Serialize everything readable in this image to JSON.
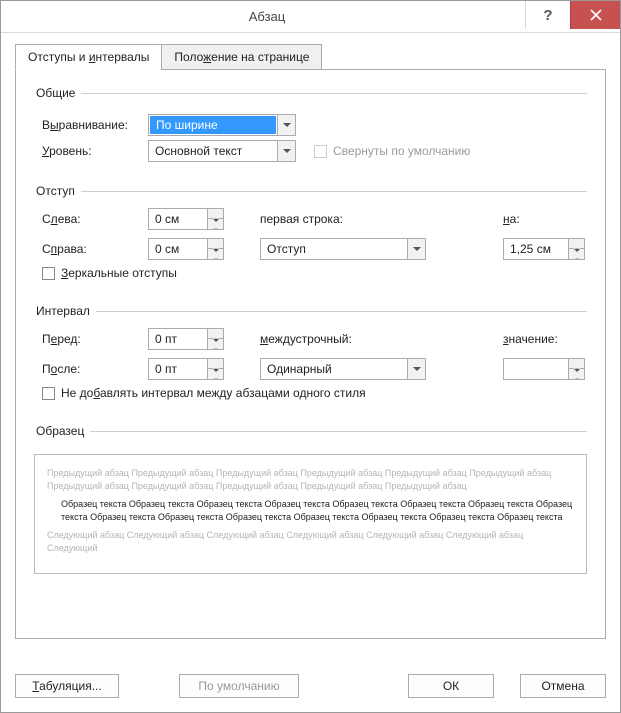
{
  "title": "Абзац",
  "tabs": {
    "indents": "Отступы и интервалы",
    "position": "Положение на странице"
  },
  "groups": {
    "general": "Общие",
    "indent": "Отступ",
    "interval": "Интервал",
    "preview": "Образец"
  },
  "general": {
    "align_label": "Выравнивание:",
    "align_value": "По ширине",
    "level_label": "Уровень:",
    "level_value": "Основной текст",
    "collapsed_label": "Свернуты по умолчанию"
  },
  "indent": {
    "left_label": "Слева:",
    "left_value": "0 см",
    "right_label": "Справа:",
    "right_value": "0 см",
    "first_line_label": "первая строка:",
    "first_combo_value": "Отступ",
    "on_label": "на:",
    "on_value": "1,25 см",
    "mirror_label": "Зеркальные отступы"
  },
  "interval": {
    "before_label": "Перед:",
    "before_value": "0 пт",
    "after_label": "После:",
    "after_value": "0 пт",
    "line_label": "междустрочный:",
    "line_value": "Одинарный",
    "value_label": "значение:",
    "value_value": "",
    "dont_add_label": "Не добавлять интервал между абзацами одного стиля"
  },
  "preview": {
    "prev_text": "Предыдущий абзац Предыдущий абзац Предыдущий абзац Предыдущий абзац Предыдущий абзац Предыдущий абзац Предыдущий абзац Предыдущий абзац Предыдущий абзац Предыдущий абзац Предыдущий абзац",
    "sample_text": "Образец текста Образец текста Образец текста Образец текста Образец текста Образец текста Образец текста Образец текста Образец текста Образец текста Образец текста Образец текста Образец текста Образец текста Образец текста",
    "next_text": "Следующий абзац Следующий абзац Следующий абзац Следующий абзац Следующий абзац Следующий абзац Следующий"
  },
  "buttons": {
    "tabs": "Табуляция...",
    "default": "По умолчанию",
    "ok": "ОК",
    "cancel": "Отмена"
  }
}
